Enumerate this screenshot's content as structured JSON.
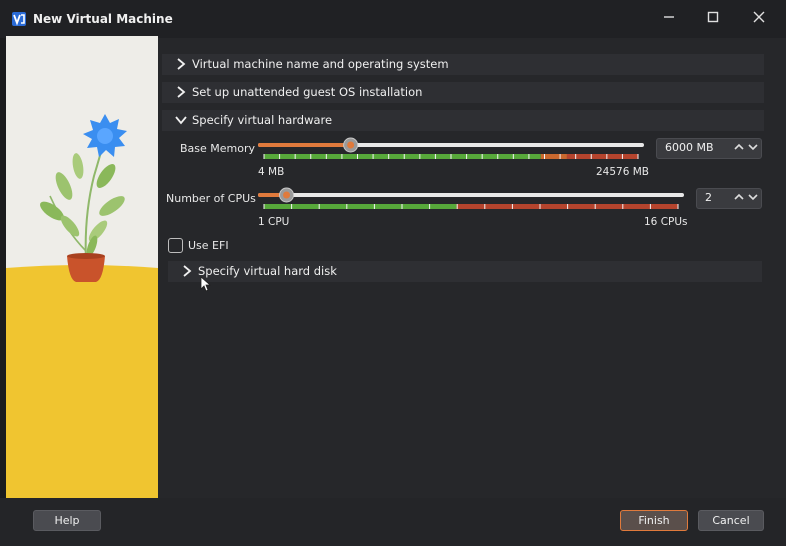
{
  "window": {
    "title": "New Virtual Machine",
    "controls": [
      "minimize-icon",
      "maximize-icon",
      "close-icon"
    ]
  },
  "sections": {
    "name_os": {
      "label": "Virtual machine name and operating system",
      "expanded": false
    },
    "unattended": {
      "label": "Set up unattended guest OS installation",
      "expanded": false
    },
    "hardware": {
      "label": "Specify virtual hardware",
      "expanded": true
    },
    "hard_disk": {
      "label": "Specify virtual hard disk",
      "expanded": false
    }
  },
  "hardware": {
    "memory": {
      "label": "Base Memory",
      "value": "6000 MB",
      "min_label": "4 MB",
      "max_label": "24576 MB",
      "level": 0.24
    },
    "cpus": {
      "label": "Number of CPUs",
      "value": "2",
      "min_label": "1 CPU",
      "max_label": "16 CPUs",
      "level": 0.067
    },
    "efi": {
      "label": "Use EFI",
      "checked": false
    }
  },
  "footer": {
    "help": "Help",
    "finish": "Finish",
    "cancel": "Cancel"
  },
  "colors": {
    "accent": "#e07a3c",
    "green": "#57a83a",
    "red": "#b5442d",
    "art_yellow": "#f0c530",
    "flower_blue": "#3a8ef0"
  }
}
